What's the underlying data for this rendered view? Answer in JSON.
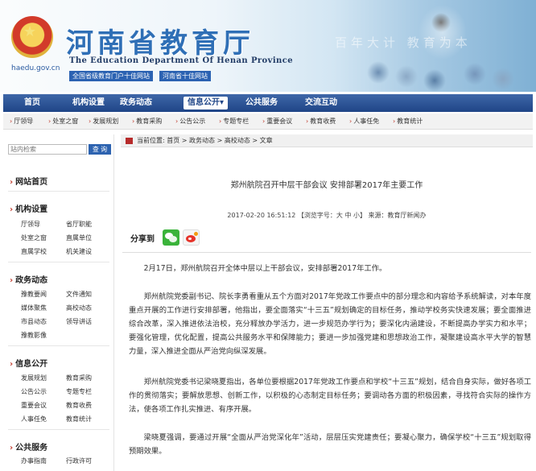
{
  "header": {
    "title_cn": "河南省教育厅",
    "title_en": "The Education Department Of Henan Province",
    "domain": "haedu.gov.cn",
    "awards": [
      "全国省级教育门户十佳网站",
      "河南省十佳网站"
    ],
    "slogan": "百年大计 教育为本"
  },
  "nav": {
    "items": [
      "首页",
      "机构设置",
      "政务动态",
      "信息公开",
      "公共服务",
      "交流互动"
    ],
    "info_dropdown_marker": "▾"
  },
  "subnav": {
    "items": [
      "厅领导",
      "处室之窗",
      "发展规划",
      "教育采购",
      "公告公示",
      "专题专栏",
      "重要会议",
      "教育收费",
      "人事任免",
      "教育统计"
    ]
  },
  "sidebar": {
    "search": {
      "placeholder": "站内检索",
      "button": "查 询"
    },
    "sections": [
      {
        "title": "网站首页",
        "links": []
      },
      {
        "title": "机构设置",
        "links": [
          "厅领导",
          "省厅职能",
          "处室之窗",
          "直属单位",
          "直属学校",
          "机关建设"
        ]
      },
      {
        "title": "政务动态",
        "links": [
          "豫教要闻",
          "文件通知",
          "媒体聚焦",
          "高校动态",
          "市县动态",
          "领导讲话",
          "豫教影像"
        ]
      },
      {
        "title": "信息公开",
        "links": [
          "发展规划",
          "教育采购",
          "公告公示",
          "专题专栏",
          "重要会议",
          "教育收费",
          "人事任免",
          "教育统计"
        ]
      },
      {
        "title": "公共服务",
        "links": [
          "办事指南",
          "行政许可"
        ]
      }
    ]
  },
  "breadcrumb": {
    "label": "当前位置:",
    "items": [
      "首页",
      "政务动态",
      "高校动态",
      "文章"
    ],
    "separator": " > "
  },
  "article": {
    "title": "郑州航院召开中层干部会议 安排部署2017年主要工作",
    "meta": "2017-02-20 16:51:12 【浏览字号：大 中 小】 来源：教育厅新闻办",
    "share_label": "分享到",
    "paragraphs": [
      "2月17日，郑州航院召开全体中层以上干部会议，安排部署2017年工作。",
      "郑州航院党委副书记、院长李勇看重从五个方面对2017年党政工作要点中的部分理念和内容给予系统解读，对本年度重点开展的工作进行安排部署，他指出，要全面落实“十三五”规划确定的目标任务，推动学校务实快速发展；要全面推进综合改革，深入推进依法治校，充分释放办学活力，进一步规范办学行为；要深化内涵建设，不断提高办学实力和水平；要强化管理，优化配置，提高公共服务水平和保障能力；要进一步加强党建和思想政治工作，凝聚建设高水平大学的智慧力量，深入推进全面从严治党向纵深发展。",
      "郑州航院党委书记梁晓夏指出，各单位要根据2017年党政工作要点和学校“十三五”规划，结合自身实际，做好各项工作的贯彻落实；要解放思想、创新工作，以积极的心态制定目标任务；要调动各方面的积极因素，寻找符合实际的操作方法，使各项工作扎实推进、有序开展。",
      "梁晓夏强调，要通过开展“全面从严治党深化年”活动，层层压实党建责任；要凝心聚力，确保学校“十三五”规划取得预期效果。"
    ]
  },
  "colors": {
    "nav_bg": "#1f4587",
    "accent_red": "#c0392b",
    "title_blue": "#2f6fb6",
    "search_button": "#2d63b0",
    "wechat_green": "#3ab33a"
  },
  "icons": [
    "national-emblem-icon",
    "wechat-icon",
    "weibo-icon",
    "arrow-icon",
    "breadcrumb-icon"
  ]
}
